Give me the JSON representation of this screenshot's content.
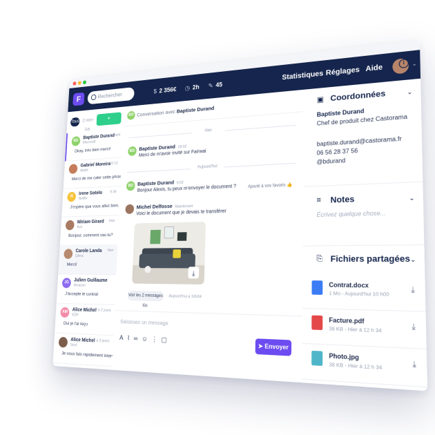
{
  "colors": {
    "navy": "#15254d",
    "accent": "#6c4cf1",
    "green": "#2ecf8a",
    "muted": "#9aa2b5"
  },
  "topbar": {
    "search_placeholder": "Rechercher",
    "stats": [
      {
        "icon": "dollar-icon",
        "value": "2 356€"
      },
      {
        "icon": "clock-icon",
        "value": "2h"
      },
      {
        "icon": "chat-icon",
        "value": "45"
      }
    ],
    "menu": [
      "Statistiques",
      "Réglages",
      "Aide"
    ]
  },
  "sidebar": {
    "filter_all": "Tous",
    "filter_unread": "2 non-lus",
    "new_conversation": "+ Conversation",
    "conversations": [
      {
        "initials": "BD",
        "color": "#8fd36b",
        "name": "Baptiste Durand",
        "company": "Microsoft",
        "time": "Maintenant",
        "msg": "Okay, très bien merci!"
      },
      {
        "initials": "",
        "color": "#c47c5a",
        "name": "Gabriel Moreira",
        "company": "Apple",
        "time": "10:12",
        "msg": "Merci de me caler cette phrase"
      },
      {
        "initials": "IS",
        "color": "#f6c23a",
        "name": "Irene Sotelo",
        "company": "Netflix",
        "time": "9:34",
        "msg": "J'espère que vous allez bien..."
      },
      {
        "initials": "",
        "color": "#a97b62",
        "name": "Miriam Girard",
        "company": "Avs",
        "time": "Hier",
        "msg": "Bonjour, comment vas-tu?"
      },
      {
        "initials": "",
        "color": "#b68a6e",
        "name": "Carole Landa",
        "company": "Qlera",
        "time": "Hier",
        "msg": "Merci!"
      },
      {
        "initials": "JG",
        "color": "#8d6cf1",
        "name": "Julien Guillaume",
        "company": "Amazon",
        "time": "",
        "msg": "J'accepte le contrat"
      },
      {
        "initials": "AM",
        "color": "#f28ca8",
        "name": "Alice Michel",
        "company": "EDF",
        "time": "il y a 2 jours",
        "msg": "Oui je l'ai reçu"
      },
      {
        "initials": "",
        "color": "#7c5e4c",
        "name": "Alice Michel",
        "company": "Sncf",
        "time": "il y a 3 jours",
        "msg": "Je vous fais rapidement intervenir pour..."
      }
    ]
  },
  "chat": {
    "header_prefix": "Conversation avec",
    "header_name": "Baptiste Durand",
    "sep_yesterday": "Hier",
    "sep_today": "Aujourd'hui",
    "messages": [
      {
        "name": "Baptiste Durand",
        "time": "18:02",
        "text": "Merci de m'avoir invité sur Fairwai"
      },
      {
        "name": "Baptiste Durand",
        "time": "9:02",
        "text": "Bonjour Alexis, tu peux m'envoyer le document ?",
        "note": "Ajouté à vos favoris 👍"
      },
      {
        "name": "Michel Delfosse",
        "time": "Maintenant",
        "text": "Voici le document que je devais te transférer"
      }
    ],
    "see_more": "Voir les 2 messages lûs",
    "see_more_time": "Aujourd'hui à 10h34",
    "composer_placeholder": "Saisissez un message",
    "send_label": "Envoyer"
  },
  "details": {
    "coords_title": "Coordonnées",
    "contact_name": "Baptiste Durand",
    "contact_role": "Chef de produit chez Castorama",
    "email": "baptiste.durand@castorama.fr",
    "phone": "06 56 28 37 56",
    "handle": "@bdurand",
    "notes_title": "Notes",
    "notes_placeholder": "Écrivez quelque chose...",
    "files_title": "Fichiers partagées",
    "files": [
      {
        "name": "Contrat.docx",
        "meta": "1 Mo - Aujourd'hui 10 h00",
        "color": "#3b7cf5"
      },
      {
        "name": "Facture.pdf",
        "meta": "38 KB - Hier à 12 h 34",
        "color": "#e54848"
      },
      {
        "name": "Photo.jpg",
        "meta": "38 KB - Hier à 12 h 34",
        "color": "#4fb6c9"
      }
    ]
  }
}
